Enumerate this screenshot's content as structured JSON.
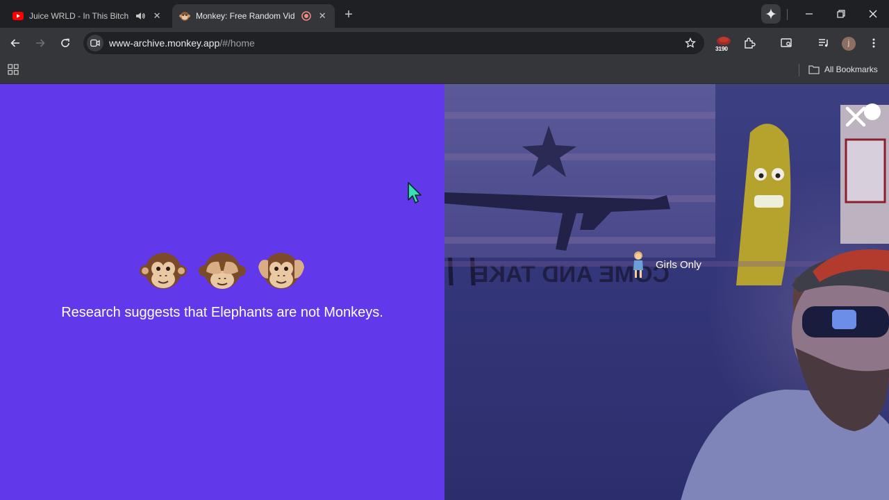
{
  "browser": {
    "tabs": [
      {
        "title": "Juice WRLD - In This Bitch (",
        "favicon": "youtube-icon",
        "audio": true,
        "active": false
      },
      {
        "title": "Monkey: Free Random Vide",
        "favicon": "monkey-icon",
        "recording": true,
        "active": true
      }
    ],
    "address": {
      "host": "www-archive.monkey.app",
      "path": "/#/home"
    },
    "extension_badge": "3190",
    "profile_initial": "j",
    "bookmarks": {
      "all_label": "All Bookmarks"
    }
  },
  "page": {
    "left": {
      "background": "#6239ea",
      "emojis": [
        "monkey-face",
        "see-no-evil-monkey",
        "hear-no-evil-monkey"
      ],
      "tagline": "Research suggests that Elephants are not Monkeys."
    },
    "right": {
      "filter_label": "Girls Only",
      "close_icon": "close-icon"
    }
  }
}
